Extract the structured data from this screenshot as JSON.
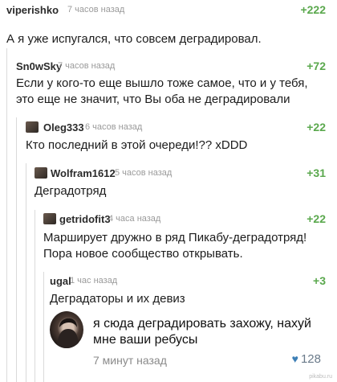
{
  "comments": [
    {
      "author": "viperishko",
      "time": "7 часов назад",
      "score": "+222",
      "text": "А я уже испугался, что совсем деградировал."
    },
    {
      "author": "Sn0wSky",
      "time": "7 часов назад",
      "score": "+72",
      "text": "Если у кого-то еще вышло тоже самое, что и у тебя, это еще не значит, что Вы оба не деградировали"
    },
    {
      "author": "Oleg333",
      "time": "6 часов назад",
      "score": "+22",
      "text": "Кто последний в этой очереди!?? xDDD"
    },
    {
      "author": "Wolfram1612",
      "time": "5 часов назад",
      "score": "+31",
      "text": "Деградотряд"
    },
    {
      "author": "getridofit3",
      "time": "4 часа назад",
      "score": "+22",
      "text": "Марширует дружно в ряд Пикабу-деградотряд! Пора новое сообщество открывать."
    },
    {
      "author": "ugal",
      "time": "1 час назад",
      "score": "+3",
      "text": "Деградаторы и их девиз"
    }
  ],
  "embed": {
    "text": "я сюда деградировать захожу, нахуй мне ваши ребусы",
    "time": "7 минут назад",
    "likes": "128"
  },
  "icons": {
    "heart": "heart-icon",
    "avatar": "avatar-image"
  },
  "colors": {
    "score": "#5aa84d",
    "rail": "#dadada",
    "heart": "#3d7fb6"
  },
  "watermark": "pikabu.ru"
}
